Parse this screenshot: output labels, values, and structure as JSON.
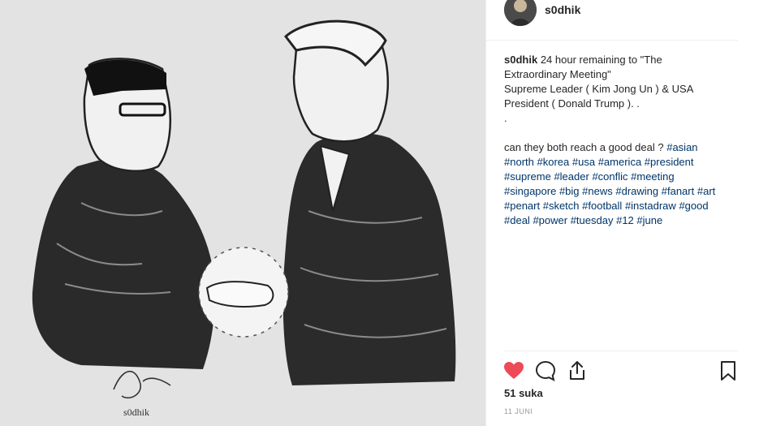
{
  "post": {
    "username": "s0dhik",
    "caption": {
      "username": "s0dhik",
      "line1": "24 hour remaining to \"The",
      "line2": "Extraordinary Meeting\"",
      "line3": "Supreme Leader ( Kim Jong Un ) & USA",
      "line4": "President ( Donald Trump ). .",
      "line5": ".",
      "question": "can they both reach a good deal ?",
      "hashtags_lines": [
        [
          "#asian"
        ],
        [
          "#north",
          "#korea",
          "#usa",
          "#america",
          "#president"
        ],
        [
          "#supreme",
          "#leader",
          "#conflic",
          "#meeting"
        ],
        [
          "#singapore",
          "#big",
          "#news",
          "#drawing",
          "#fanart",
          "#art"
        ],
        [
          "#penart",
          "#sketch",
          "#football",
          "#instadraw",
          "#good"
        ],
        [
          "#deal",
          "#power",
          "#tuesday",
          "#12",
          "#june"
        ]
      ]
    },
    "likes": "51 suka",
    "date": "11 JUNI",
    "image": {
      "signature": "s0dhik"
    }
  },
  "icons": {
    "like": "heart-icon",
    "comment": "comment-icon",
    "share": "share-icon",
    "save": "bookmark-icon"
  },
  "colors": {
    "heart": "#ed4956",
    "hashtag": "#003569",
    "text": "#262626"
  }
}
